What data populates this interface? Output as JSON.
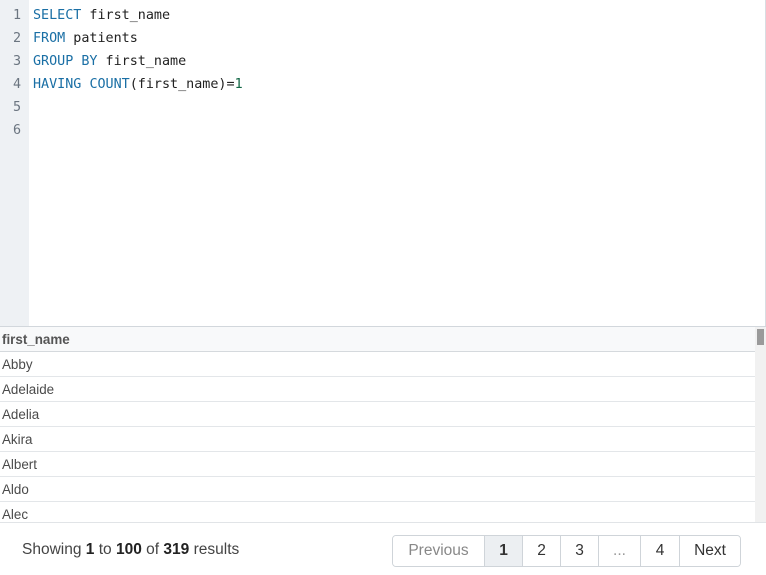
{
  "editor": {
    "lines": [
      {
        "num": "1",
        "tokens": [
          {
            "t": "SELECT",
            "k": "kw"
          },
          {
            "t": " first_name",
            "k": ""
          }
        ]
      },
      {
        "num": "2",
        "tokens": [
          {
            "t": "FROM",
            "k": "kw"
          },
          {
            "t": " patients",
            "k": ""
          }
        ]
      },
      {
        "num": "3",
        "tokens": [
          {
            "t": "GROUP BY",
            "k": "kw"
          },
          {
            "t": " first_name",
            "k": ""
          }
        ]
      },
      {
        "num": "4",
        "tokens": [
          {
            "t": "HAVING",
            "k": "kw"
          },
          {
            "t": " ",
            "k": ""
          },
          {
            "t": "COUNT",
            "k": "kw"
          },
          {
            "t": "(first_name)=",
            "k": ""
          },
          {
            "t": "1",
            "k": "num"
          }
        ]
      },
      {
        "num": "5",
        "tokens": []
      },
      {
        "num": "6",
        "tokens": []
      }
    ]
  },
  "results": {
    "column": "first_name",
    "rows": [
      "Abby",
      "Adelaide",
      "Adelia",
      "Akira",
      "Albert",
      "Aldo",
      "Alec"
    ]
  },
  "footer": {
    "showing": "Showing",
    "from": "1",
    "to_word": "to",
    "to": "100",
    "of_word": "of",
    "total": "319",
    "results_word": "results"
  },
  "pagination": {
    "previous": "Previous",
    "pages": [
      "1",
      "2",
      "3"
    ],
    "ellipsis": "...",
    "last": "4",
    "next": "Next",
    "current": "1"
  }
}
